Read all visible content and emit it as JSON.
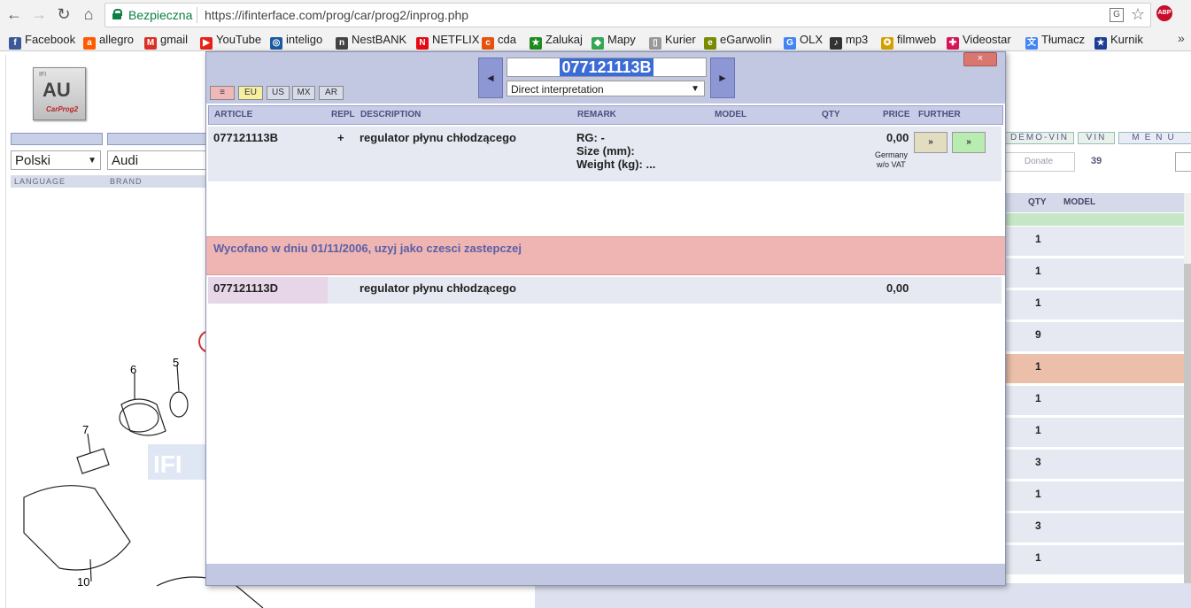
{
  "browser": {
    "secure_label": "Bezpieczna",
    "url": "https://ifinterface.com/prog/car/prog2/inprog.php",
    "abp_label": "ABP",
    "more": "»"
  },
  "bookmarks": [
    {
      "label": "Facebook",
      "color": "#3b5998",
      "glyph": "f"
    },
    {
      "label": "allegro",
      "color": "#ff5a00",
      "glyph": "a"
    },
    {
      "label": "gmail",
      "color": "#d93025",
      "glyph": "M"
    },
    {
      "label": "YouTube",
      "color": "#e62117",
      "glyph": "▶"
    },
    {
      "label": "inteligo",
      "color": "#1a5a9e",
      "glyph": "◎"
    },
    {
      "label": "NestBANK",
      "color": "#444",
      "glyph": "n"
    },
    {
      "label": "NETFLIX",
      "color": "#e50914",
      "glyph": "N"
    },
    {
      "label": "cda",
      "color": "#e5530f",
      "glyph": "c"
    },
    {
      "label": "Zalukaj",
      "color": "#1e8b1e",
      "glyph": "★"
    },
    {
      "label": "Mapy",
      "color": "#34a853",
      "glyph": "◆"
    },
    {
      "label": "Kurier",
      "color": "#999",
      "glyph": "▯"
    },
    {
      "label": "eGarwolin",
      "color": "#7a8b00",
      "glyph": "e"
    },
    {
      "label": "OLX",
      "color": "#4285f4",
      "glyph": "G"
    },
    {
      "label": "mp3",
      "color": "#333",
      "glyph": "♪"
    },
    {
      "label": "filmweb",
      "color": "#d4a000",
      "glyph": "✪"
    },
    {
      "label": "Videostar",
      "color": "#d8175a",
      "glyph": "✚"
    },
    {
      "label": "Tłumacz",
      "color": "#4285f4",
      "glyph": "文"
    },
    {
      "label": "Kurnik",
      "color": "#1c3f94",
      "glyph": "★"
    }
  ],
  "page": {
    "logo": {
      "main": "AU",
      "top": "IFI",
      "sub": "CarProg2"
    },
    "language": "Polski",
    "brand": "Audi",
    "language_label": "LANGUAGE",
    "brand_label": "BRAND",
    "buttons": {
      "demo_vin": "DEMO-VIN",
      "vin": "VIN",
      "menu": "MENU"
    },
    "donate": "Donate",
    "count": "39",
    "right_table": {
      "qty_header": "QTY",
      "model_header": "MODEL",
      "qtys": [
        "1",
        "1",
        "1",
        "9",
        "1",
        "1",
        "1",
        "3",
        "1",
        "3",
        "1"
      ]
    },
    "diagram_labels": [
      "6",
      "5",
      "7",
      "10"
    ],
    "watermark": "IFI"
  },
  "popup": {
    "regions": [
      "≡",
      "EU",
      "US",
      "MX",
      "AR"
    ],
    "search_value": "077121113B",
    "interpretation": "Direct interpretation",
    "close": "×",
    "columns": {
      "article": "ARTICLE",
      "repl": "REPL",
      "description": "DESCRIPTION",
      "remark": "REMARK",
      "model": "MODEL",
      "qty": "QTY",
      "price": "PRICE",
      "further": "FURTHER"
    },
    "row1": {
      "article": "077121113B",
      "repl": "+",
      "description": "regulator płynu chłodzącego",
      "remark_rg": "RG: -",
      "remark_size": "Size (mm):",
      "remark_weight": "Weight (kg): ...",
      "price": "0,00",
      "price_note1": "Germany",
      "price_note2": "w/o VAT",
      "btn1": "»",
      "btn2": "»"
    },
    "notice": "Wycofano w dniu 01/11/2006, uzyj jako czesci zastepczej",
    "row2": {
      "article": "077121113D",
      "description": "regulator płynu chłodzącego",
      "price": "0,00"
    }
  }
}
